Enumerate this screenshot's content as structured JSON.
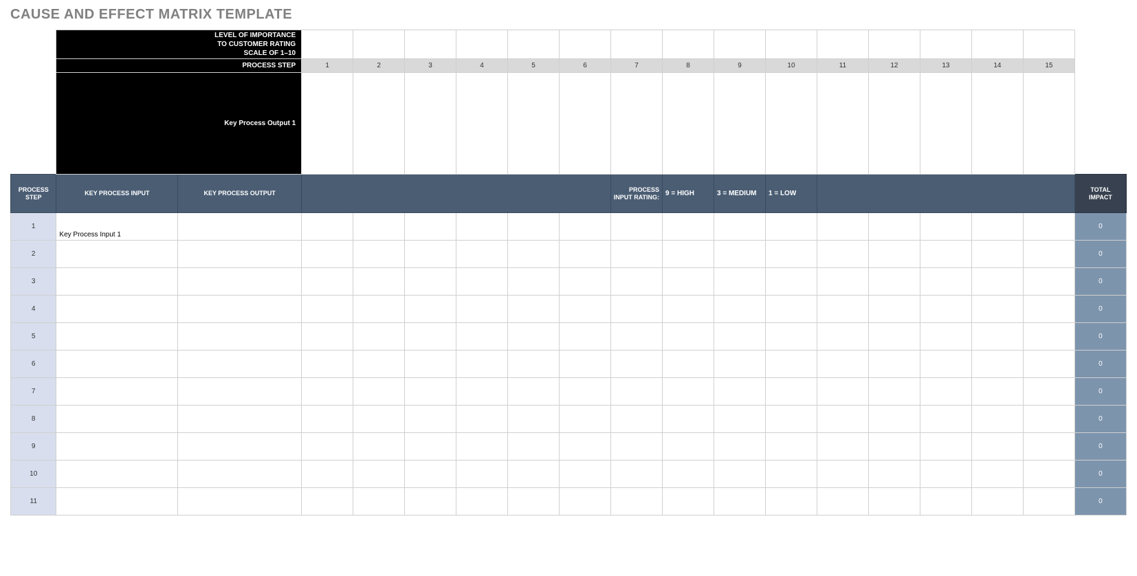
{
  "title": "CAUSE AND EFFECT MATRIX TEMPLATE",
  "header": {
    "importance_line1": "LEVEL OF IMPORTANCE",
    "importance_line2": "TO CUSTOMER RATING",
    "importance_line3": "SCALE OF 1–10",
    "process_step_label": "PROCESS STEP",
    "key_output_label": "Key Process Output 1",
    "step_numbers": [
      "1",
      "2",
      "3",
      "4",
      "5",
      "6",
      "7",
      "8",
      "9",
      "10",
      "11",
      "12",
      "13",
      "14",
      "15"
    ]
  },
  "columns": {
    "process_step": "PROCESS STEP",
    "key_process_input": "KEY PROCESS INPUT",
    "key_process_output": "KEY PROCESS OUTPUT",
    "rating_label_1": "PROCESS",
    "rating_label_2": "INPUT RATING:",
    "rating_high": "9  =  HIGH",
    "rating_medium": "3  =  MEDIUM",
    "rating_low": "1  =  LOW",
    "total_impact": "TOTAL IMPACT"
  },
  "rows": [
    {
      "num": "1",
      "input": "Key Process Input 1",
      "impact": "0"
    },
    {
      "num": "2",
      "input": "",
      "impact": "0"
    },
    {
      "num": "3",
      "input": "",
      "impact": "0"
    },
    {
      "num": "4",
      "input": "",
      "impact": "0"
    },
    {
      "num": "5",
      "input": "",
      "impact": "0"
    },
    {
      "num": "6",
      "input": "",
      "impact": "0"
    },
    {
      "num": "7",
      "input": "",
      "impact": "0"
    },
    {
      "num": "8",
      "input": "",
      "impact": "0"
    },
    {
      "num": "9",
      "input": "",
      "impact": "0"
    },
    {
      "num": "10",
      "input": "",
      "impact": "0"
    },
    {
      "num": "11",
      "input": "",
      "impact": "0"
    }
  ]
}
